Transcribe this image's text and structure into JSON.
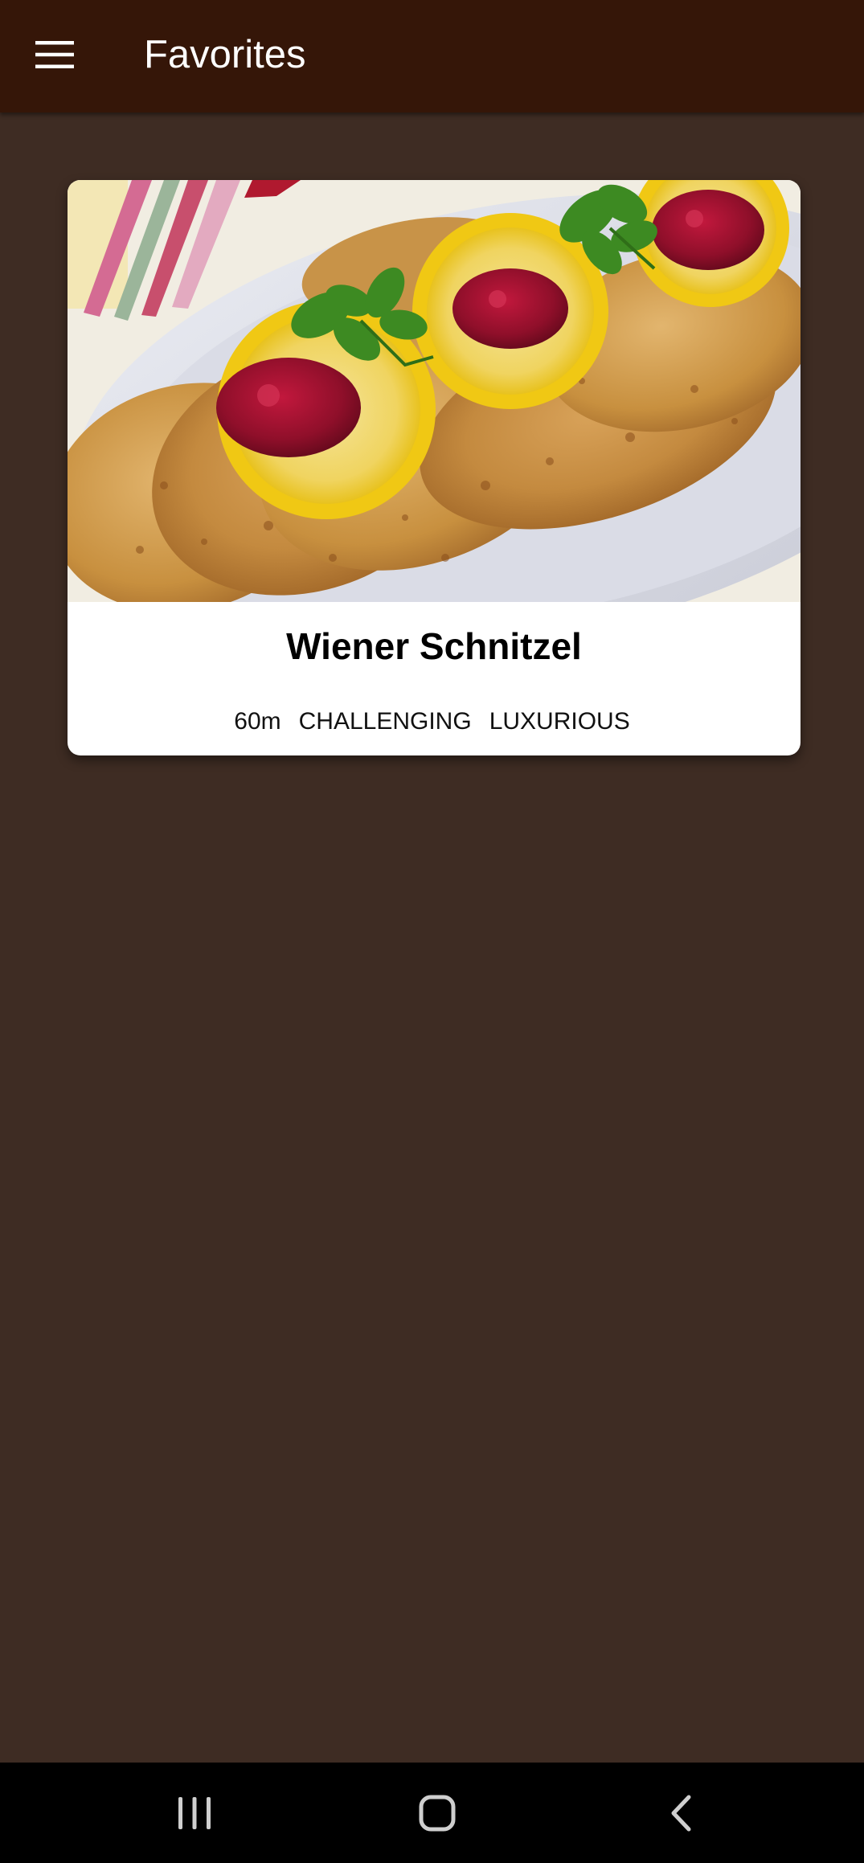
{
  "app_bar": {
    "title": "Favorites",
    "background": "#351608",
    "menu_icon": "hamburger-menu-icon"
  },
  "page": {
    "background": "#3e2c23"
  },
  "favorites": [
    {
      "title": "Wiener Schnitzel",
      "duration": "60m",
      "complexity": "CHALLENGING",
      "affordability": "LUXURIOUS",
      "image_icon": "schnitzel-photo"
    }
  ],
  "system_nav": {
    "background": "#000000",
    "recents_icon": "recent-apps-icon",
    "home_icon": "home-icon",
    "back_icon": "back-icon"
  }
}
